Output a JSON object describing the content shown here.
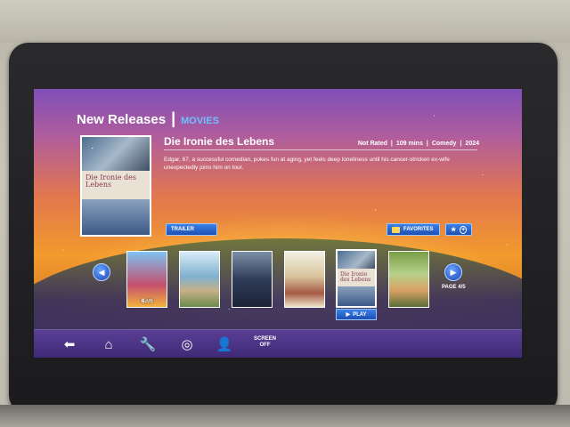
{
  "header": {
    "title": "New Releases",
    "separator": "|",
    "category": "MOVIES"
  },
  "featured": {
    "title": "Die Ironie des Lebens",
    "rating": "Not Rated",
    "duration": "109 mins",
    "genre": "Comedy",
    "year": "2024",
    "meta_sep": "|",
    "synopsis": "Edgar, 67, a successful comedian, pokes fun at aging, yet feels deep loneliness until his cancer-stricken ex-wife unexpectedly joins him on tour.",
    "poster_text": "Die Ironie des Lebens"
  },
  "buttons": {
    "trailer": "TRAILER",
    "favorites": "FAVORITES",
    "add": "+",
    "play": "PLAY"
  },
  "carousel": {
    "page_indicator": "PAGE 4/5",
    "items": [
      {
        "label": "록스타"
      },
      {
        "label": ""
      },
      {
        "label": ""
      },
      {
        "label": ""
      },
      {
        "label": "Die Ironie des Lebens"
      },
      {
        "label": ""
      }
    ],
    "selected_index": 4
  },
  "nav": {
    "screen_off_line1": "SCREEN",
    "screen_off_line2": "OFF"
  },
  "icons": {
    "back": "back-arrow-icon",
    "home": "home-icon",
    "settings": "wrench-icon",
    "moving_map": "compass-icon",
    "attendant": "attendant-call-icon"
  },
  "colors": {
    "accent_blue": "#3b82e6",
    "category_blue": "#6fc0ff",
    "nav_purple": "#5a3f96"
  }
}
